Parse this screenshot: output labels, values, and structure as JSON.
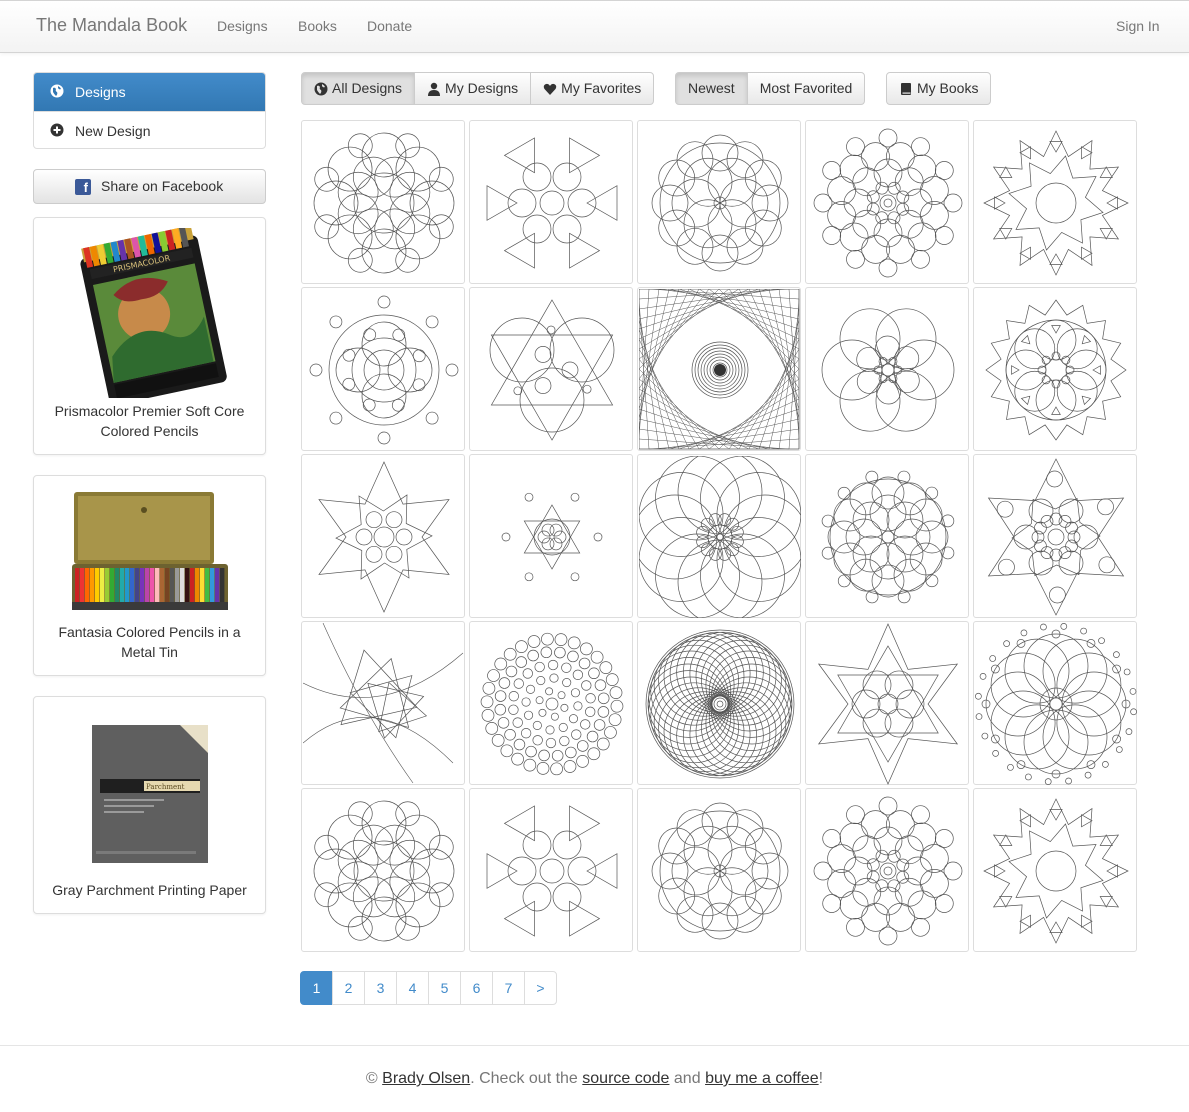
{
  "navbar": {
    "brand": "The Mandala Book",
    "links": [
      "Designs",
      "Books",
      "Donate"
    ],
    "sign_in": "Sign In"
  },
  "sidebar": {
    "items": [
      {
        "label": "Designs",
        "icon": "globe-icon",
        "active": true
      },
      {
        "label": "New Design",
        "icon": "plus-circle-icon",
        "active": false
      }
    ],
    "share_button": {
      "label": "Share on Facebook",
      "icon": "facebook-icon"
    },
    "products": [
      {
        "title": "Prismacolor Premier Soft Core Colored Pencils",
        "image": "prismacolor-tin-image"
      },
      {
        "title": "Fantasia Colored Pencils in a Metal Tin",
        "image": "fantasia-tin-image"
      },
      {
        "title": "Gray Parchment Printing Paper",
        "image": "parchment-paper-image"
      }
    ]
  },
  "toolbar": {
    "filter": [
      {
        "label": "All Designs",
        "icon": "globe-icon",
        "active": true
      },
      {
        "label": "My Designs",
        "icon": "user-icon",
        "active": false
      },
      {
        "label": "My Favorites",
        "icon": "heart-icon",
        "active": false
      }
    ],
    "sort": [
      {
        "label": "Newest",
        "active": true
      },
      {
        "label": "Most Favorited",
        "active": false
      }
    ],
    "books": {
      "label": "My Books",
      "icon": "book-icon"
    }
  },
  "designs": {
    "rows": 5,
    "columns": 5,
    "tiles": [
      "circle-cluster",
      "triangle-pattern",
      "petal-rosette",
      "dense-circle-ring",
      "star-triangle",
      "spaced-circles",
      "triangle-circles",
      "string-art",
      "petal-rosette-large",
      "star-rosette",
      "double-star",
      "small-star-dots",
      "petal-arcs",
      "circle-ring-center",
      "hexagram-rosette",
      "arc-triangles",
      "dot-field",
      "spirograph",
      "triangle-hexagram",
      "ring-of-circles",
      "circle-cluster",
      "triangle-pattern",
      "petal-rosette",
      "dense-circle-ring",
      "star-triangle"
    ]
  },
  "pagination": {
    "pages": [
      "1",
      "2",
      "3",
      "4",
      "5",
      "6",
      "7"
    ],
    "next": ">",
    "current": "1"
  },
  "footer": {
    "copyright": "©",
    "author": "Brady Olsen",
    "text1": ". Check out the",
    "source_link": "source code",
    "text2": "and",
    "coffee_link": "buy me a coffee",
    "end": "!"
  },
  "colors": {
    "accent": "#428bca",
    "facebook": "#3b5998",
    "line": "#555555"
  }
}
